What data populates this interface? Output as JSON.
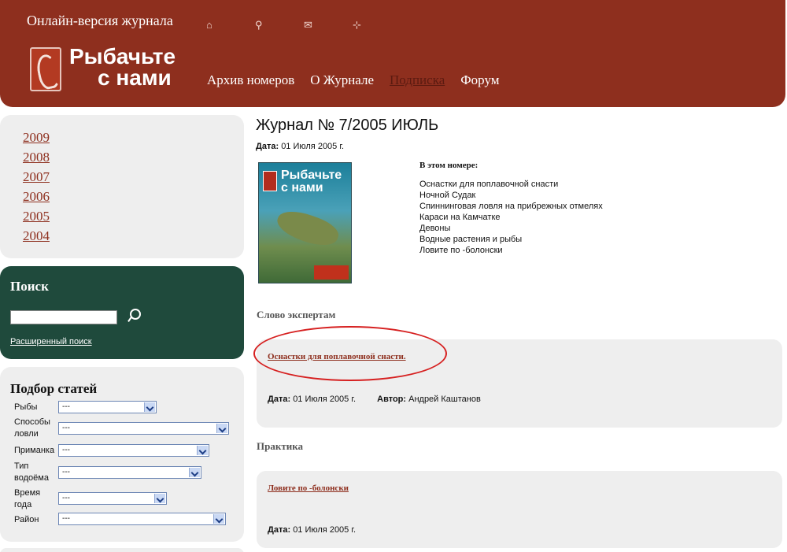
{
  "header": {
    "tagline": "Онлайн-версия журнала",
    "icons": [
      "home-icon",
      "search-icon",
      "mail-icon",
      "sitemap-icon"
    ],
    "brand_line1": "Рыбачьте",
    "brand_line2": "с нами",
    "nav": [
      "Архив номеров",
      "О Журнале",
      "Подписка",
      "Форум"
    ]
  },
  "sidebar": {
    "years": [
      "2009",
      "2008",
      "2007",
      "2006",
      "2005",
      "2004"
    ],
    "search": {
      "title": "Поиск",
      "input_value": "",
      "advanced_link": "Расширенный поиск"
    },
    "filter": {
      "title": "Подбор статей",
      "rows": [
        {
          "label": "Рыбы",
          "value": "---"
        },
        {
          "label": "Способы ловли",
          "value": "---"
        },
        {
          "label": "Приманка",
          "value": "---"
        },
        {
          "label": "Тип водоёма",
          "value": "---"
        },
        {
          "label": "Время года",
          "value": "---"
        },
        {
          "label": "Район",
          "value": "---"
        }
      ]
    }
  },
  "main": {
    "title": "Журнал № 7/2005 ИЮЛЬ",
    "date_label": "Дата:",
    "date_value": "01 Июля 2005 г.",
    "cover_title": "Рыбачьте с нами",
    "in_issue_heading": "В этом номере:",
    "in_issue": [
      "Оснастки для поплавочной снасти",
      "Ночной Судак",
      "Спиннинговая ловля на прибрежных отмелях",
      "Караси на Камчатке",
      "Девоны",
      "Водные растения и рыбы",
      "Ловите по -болонски"
    ],
    "sections": [
      {
        "heading": "Слово экспертам",
        "article": "Оснастки для поплавочной снасти.",
        "date_label": "Дата:",
        "date": "01 Июля 2005 г.",
        "author_label": "Автор:",
        "author": "Андрей Каштанов"
      },
      {
        "heading": "Практика",
        "article": "Ловите по -болонски",
        "date_label": "Дата:",
        "date": "01 Июля 2005 г."
      }
    ]
  }
}
